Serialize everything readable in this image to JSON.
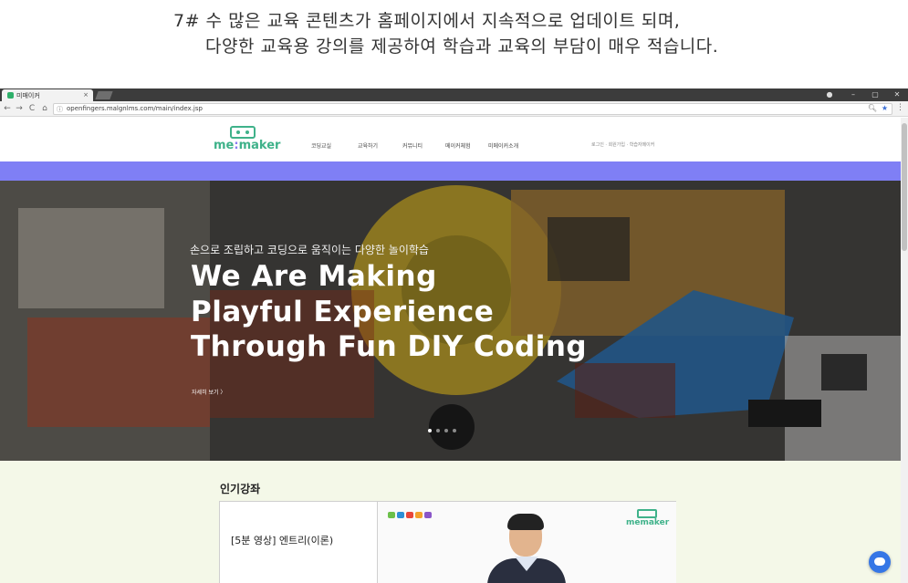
{
  "caption": {
    "line1": "7# 수 많은 교육 콘텐츠가 홈페이지에서 지속적으로 업데이트 되며,",
    "line2": "다양한 교육용 강의를 제공하여 학습과 교육의 부담이 매우 적습니다."
  },
  "browser": {
    "tab_title": "미매이커",
    "tab_close": "×",
    "url": "openfingers.malgnlms.com/main/index.jsp",
    "controls": {
      "user": "●",
      "minimize": "–",
      "maximize": "▢",
      "close": "✕"
    },
    "nav": {
      "back": "←",
      "forward": "→",
      "reload": "C",
      "home": "⌂"
    }
  },
  "site": {
    "logo": {
      "pre": "me",
      "colon": ":",
      "post": "maker"
    },
    "nav": [
      "코딩교실",
      "교육하기",
      "커뮤니티",
      "메이커체험",
      "미메이커소개"
    ],
    "utility": "로그인 · 회원가입 · 학습자메이커"
  },
  "hero": {
    "subtitle": "손으로 조립하고 코딩으로 움직이는 다양한 놀이학습",
    "headline": [
      "We Are Making",
      "Playful Experience",
      "Through Fun DIY Coding"
    ],
    "more_link": "자세히 보기  〉",
    "slides": 4,
    "active_slide": 1
  },
  "popular": {
    "heading": "인기강좌",
    "course_title": "[5분 영상] 엔트리(이론)",
    "thumb_logo": "memaker"
  },
  "colors": {
    "brand_green": "#3fb28a",
    "accent_purple": "#7f7ff5",
    "section_bg": "#f4f8e8",
    "chat_blue": "#3576e6"
  }
}
